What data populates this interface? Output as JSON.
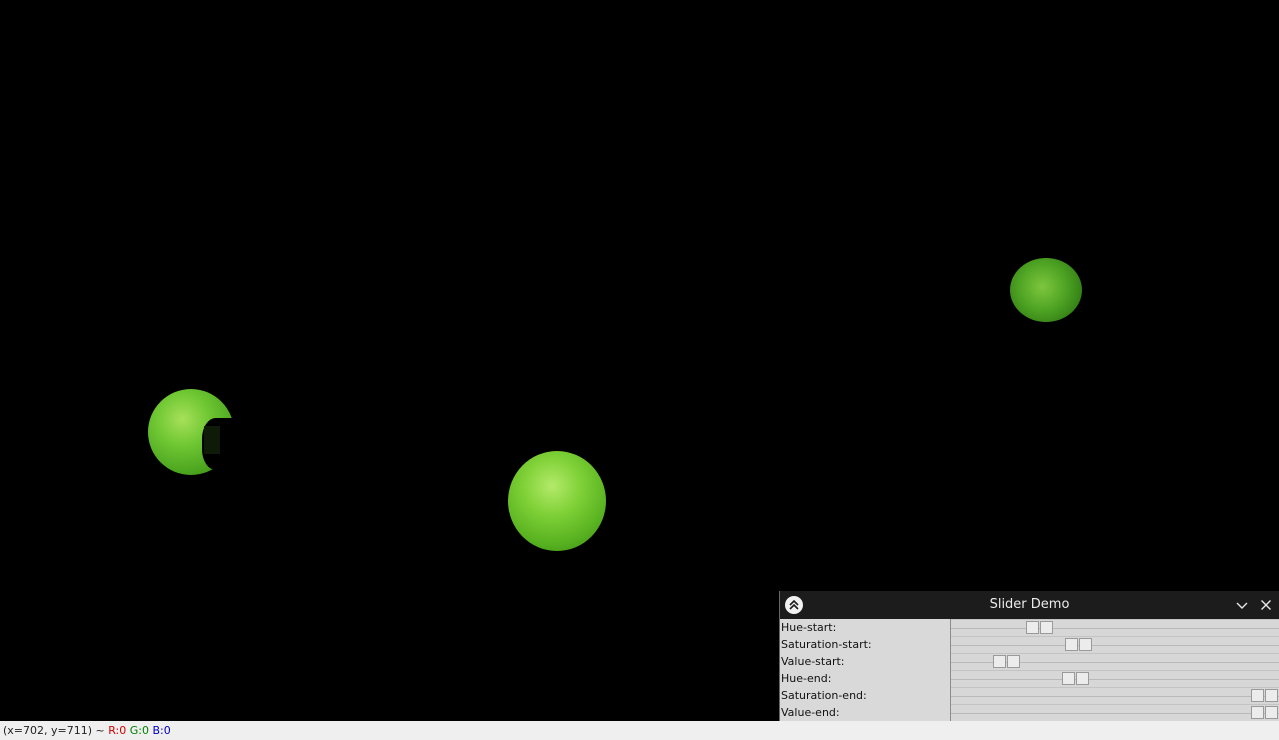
{
  "window": {
    "title": "Slider Demo"
  },
  "status": {
    "coords": "(x=702, y=711) ~",
    "r": "R:0",
    "g": "G:0",
    "b": "B:0"
  },
  "sliders": [
    {
      "label": "Hue-start:",
      "level_pct": 25
    },
    {
      "label": "Saturation-start:",
      "level_pct": 38
    },
    {
      "label": "Value-start:",
      "level_pct": 14
    },
    {
      "label": "Hue-end:",
      "level_pct": 37
    },
    {
      "label": "Saturation-end:",
      "level_pct": 100
    },
    {
      "label": "Value-end:",
      "level_pct": 100
    }
  ],
  "icons": {
    "app": "double-chevron-up-icon",
    "minimize": "chevron-down-icon",
    "close": "close-icon"
  },
  "colors": {
    "canvas_bg": "#000000",
    "titlebar_bg": "#1c1c1c",
    "panel_bg": "#d9d9d9",
    "pea_green": "#6fc733"
  }
}
